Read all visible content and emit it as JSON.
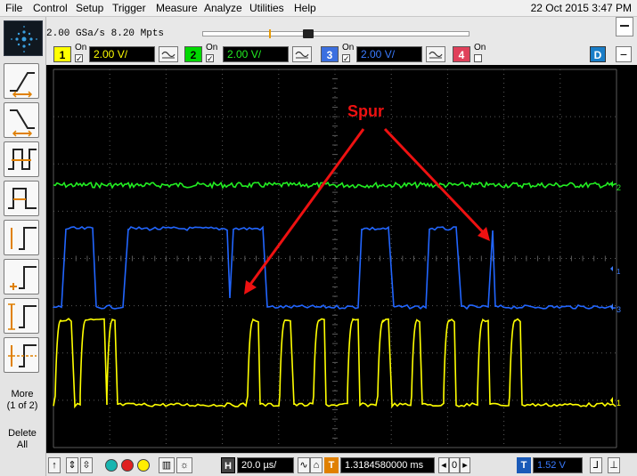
{
  "menu": {
    "items": [
      "File",
      "Control",
      "Setup",
      "Trigger",
      "Measure",
      "Analyze",
      "Utilities",
      "Help"
    ],
    "datetime": "22 Oct 2015  3:47 PM"
  },
  "status": {
    "sample_rate": "2.00 GSa/s    8.20 Mpts"
  },
  "channels": [
    {
      "number": "1",
      "on_label": "On",
      "checked": "✓",
      "scale": "2.00 V/",
      "color": "#ffff00",
      "tag_bg": "#ffff00"
    },
    {
      "number": "2",
      "on_label": "On",
      "checked": "✓",
      "scale": "2.00 V/",
      "color": "#00ff00",
      "tag_bg": "#00d800"
    },
    {
      "number": "3",
      "on_label": "On",
      "checked": "✓",
      "scale": "2.00 V/",
      "color": "#2266ff",
      "tag_bg": "#3b6fe0"
    },
    {
      "number": "4",
      "on_label": "On",
      "checked": "",
      "scale": "",
      "color": "#ff3333",
      "tag_bg": "#e0405a"
    }
  ],
  "digital_button": "D",
  "sidebar": {
    "more_label": "More\n(1 of 2)",
    "delete_all_label": "Delete\nAll",
    "tools": [
      "rising-edge-measure-icon",
      "falling-edge-measure-icon",
      "period-measure-icon",
      "pulse-width-measure-icon",
      "amplitude-measure-icon",
      "top-measure-icon",
      "peak-to-peak-measure-icon",
      "average-measure-icon"
    ]
  },
  "annotation": {
    "label": "Spur",
    "color": "#ee1111"
  },
  "markers": {
    "ch2": "2",
    "ch3": "3",
    "ch1": "1",
    "offset": "1"
  },
  "bottom": {
    "horizontal_tag": "H",
    "timebase": "20.0 µs/",
    "trigger_tag": "T",
    "delay": "1.3184580000 ms",
    "delay_zero": "0",
    "trigger_level_tag": "T",
    "trigger_level": "1.52 V"
  },
  "colors": {
    "ch1": "#ffff00",
    "ch2": "#22ee22",
    "ch3": "#2266ff",
    "grid": "#5a5a5a",
    "display_bg": "#000000"
  }
}
